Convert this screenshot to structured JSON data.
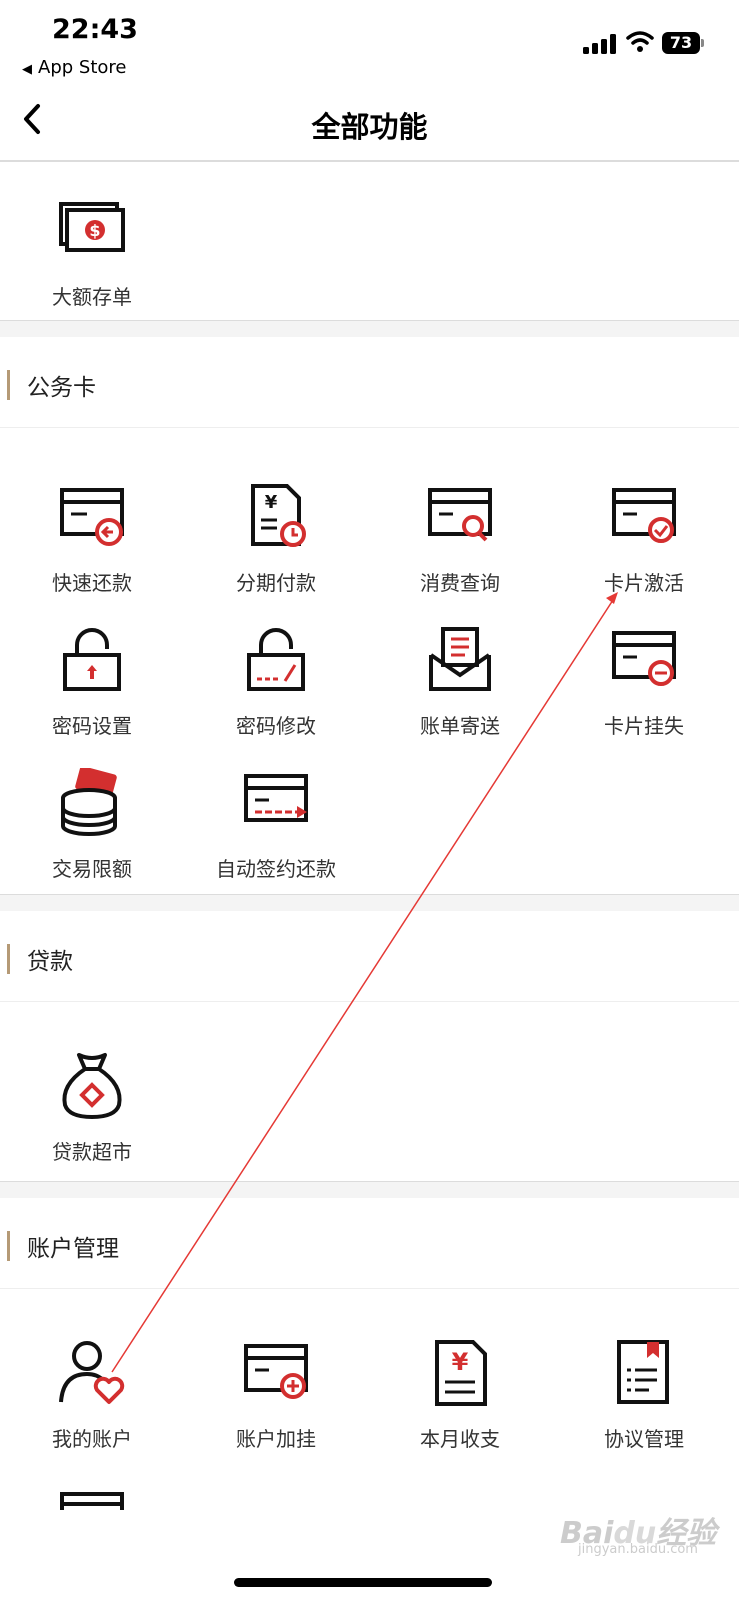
{
  "status_bar": {
    "time": "22:43",
    "back_app": "App Store",
    "battery": "73"
  },
  "nav": {
    "title": "全部功能"
  },
  "top_items": [
    {
      "label": "大额存单",
      "icon": "deposit-money-icon"
    }
  ],
  "sections": [
    {
      "title": "公务卡",
      "items": [
        {
          "label": "快速还款",
          "icon": "card-repay-icon"
        },
        {
          "label": "分期付款",
          "icon": "installment-icon"
        },
        {
          "label": "消费查询",
          "icon": "card-search-icon"
        },
        {
          "label": "卡片激活",
          "icon": "card-activate-icon"
        },
        {
          "label": "密码设置",
          "icon": "lock-set-icon"
        },
        {
          "label": "密码修改",
          "icon": "lock-edit-icon"
        },
        {
          "label": "账单寄送",
          "icon": "bill-mail-icon"
        },
        {
          "label": "卡片挂失",
          "icon": "card-lost-icon"
        },
        {
          "label": "交易限额",
          "icon": "coin-limit-icon"
        },
        {
          "label": "自动签约还款",
          "icon": "auto-repay-icon"
        }
      ]
    },
    {
      "title": "贷款",
      "items": [
        {
          "label": "贷款超市",
          "icon": "money-bag-icon"
        }
      ]
    },
    {
      "title": "账户管理",
      "items": [
        {
          "label": "我的账户",
          "icon": "user-heart-icon"
        },
        {
          "label": "账户加挂",
          "icon": "card-add-icon"
        },
        {
          "label": "本月收支",
          "icon": "yen-doc-icon"
        },
        {
          "label": "协议管理",
          "icon": "agreement-icon"
        }
      ]
    }
  ],
  "watermark": {
    "logo": "Baidu经验",
    "url": "jingyan.baidu.com"
  },
  "colors": {
    "accent": "#d32f2f",
    "section_bar": "#b59a76",
    "gap": "#f4f4f4"
  }
}
